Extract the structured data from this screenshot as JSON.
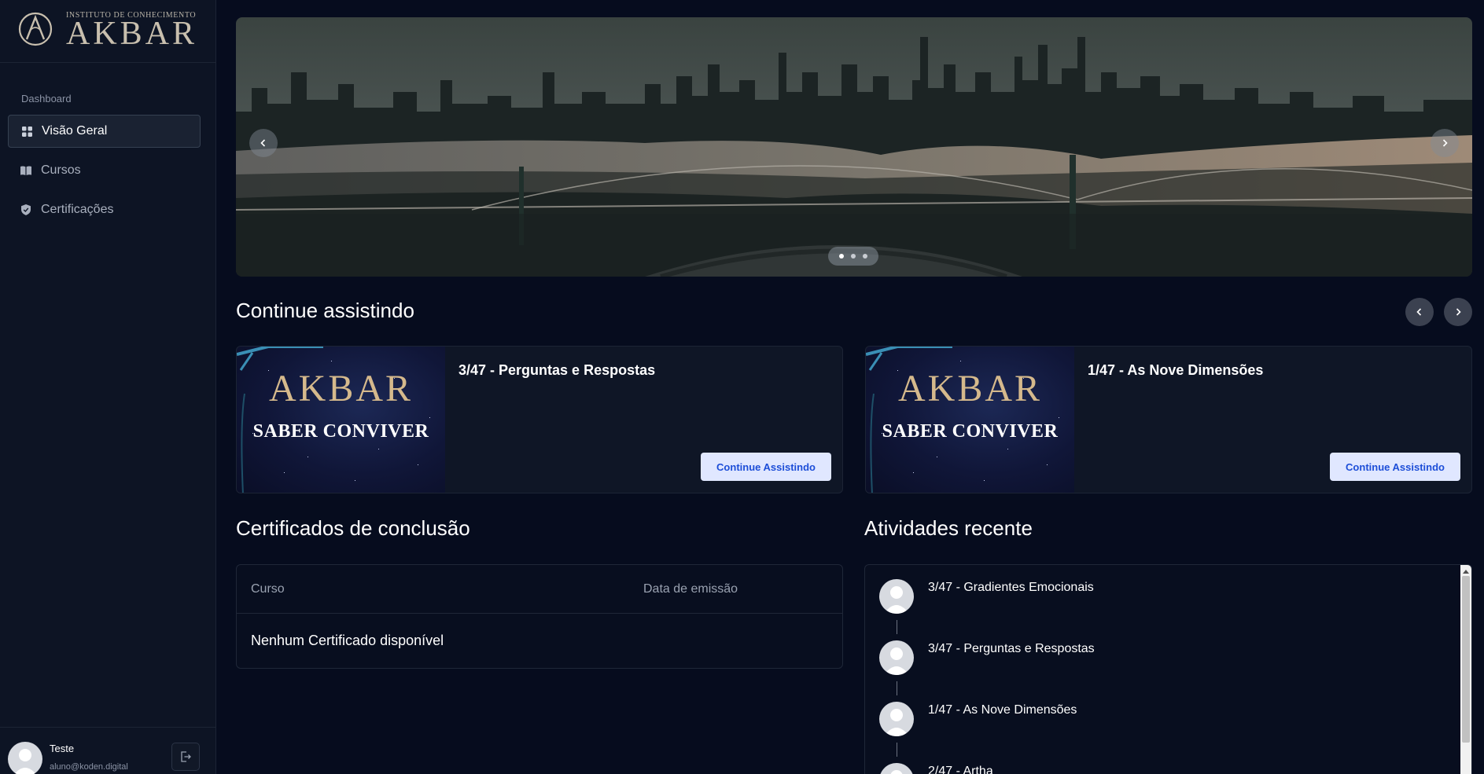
{
  "brand": {
    "small_text": "INSTITUTO DE CONHECIMENTO",
    "name": "AKBAR"
  },
  "sidebar": {
    "section_label": "Dashboard",
    "items": [
      {
        "label": "Visão Geral",
        "icon": "grid-icon",
        "active": true
      },
      {
        "label": "Cursos",
        "icon": "book-icon",
        "active": false
      },
      {
        "label": "Certificações",
        "icon": "shield-icon",
        "active": false
      }
    ],
    "user": {
      "name": "Teste",
      "email": "aluno@koden.digital"
    }
  },
  "hero": {
    "slides": 3,
    "active_slide": 1
  },
  "continue_watching": {
    "title": "Continue assistindo",
    "cards": [
      {
        "thumb_title": "AKBAR",
        "thumb_subtitle": "SABER CONVIVER",
        "title": "3/47 - Perguntas e Respostas",
        "button": "Continue Assistindo"
      },
      {
        "thumb_title": "AKBAR",
        "thumb_subtitle": "SABER CONVIVER",
        "title": "1/47 - As Nove Dimensões",
        "button": "Continue Assistindo"
      }
    ]
  },
  "certificates": {
    "title": "Certificados de conclusão",
    "columns": [
      "Curso",
      "Data de emissão"
    ],
    "empty_text": "Nenhum Certificado disponível"
  },
  "activities": {
    "title": "Atividades recente",
    "items": [
      "3/47 - Gradientes Emocionais",
      "3/47 - Perguntas e Respostas",
      "1/47 - As Nove Dimensões",
      "2/47 - Artha"
    ]
  },
  "colors": {
    "background": "#060c1e",
    "sidebar": "#0d1424",
    "button_bg": "#e0e7ff",
    "button_text": "#1d4ed8"
  }
}
